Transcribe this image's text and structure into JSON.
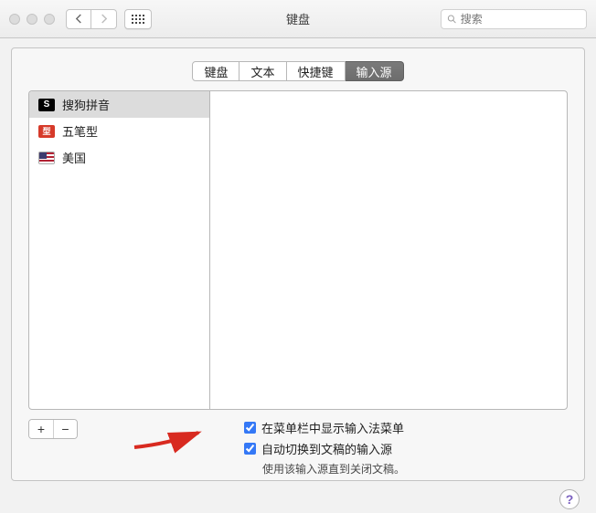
{
  "window": {
    "title": "键盘"
  },
  "search": {
    "placeholder": "搜索"
  },
  "tabs": [
    {
      "label": "键盘",
      "selected": false
    },
    {
      "label": "文本",
      "selected": false
    },
    {
      "label": "快捷键",
      "selected": false
    },
    {
      "label": "输入源",
      "selected": true
    }
  ],
  "sources": [
    {
      "label": "搜狗拼音",
      "icon": "sogou",
      "icon_text": "S",
      "selected": true
    },
    {
      "label": "五笔型",
      "icon": "wubi",
      "icon_text": "型",
      "selected": false
    },
    {
      "label": "美国",
      "icon": "flag-us",
      "icon_text": "",
      "selected": false
    }
  ],
  "add_label": "+",
  "remove_label": "−",
  "checks": {
    "show_menu": {
      "label": "在菜单栏中显示输入法菜单",
      "checked": true
    },
    "auto_switch": {
      "label": "自动切换到文稿的输入源",
      "checked": true
    },
    "note": "使用该输入源直到关闭文稿。"
  },
  "help_label": "?"
}
